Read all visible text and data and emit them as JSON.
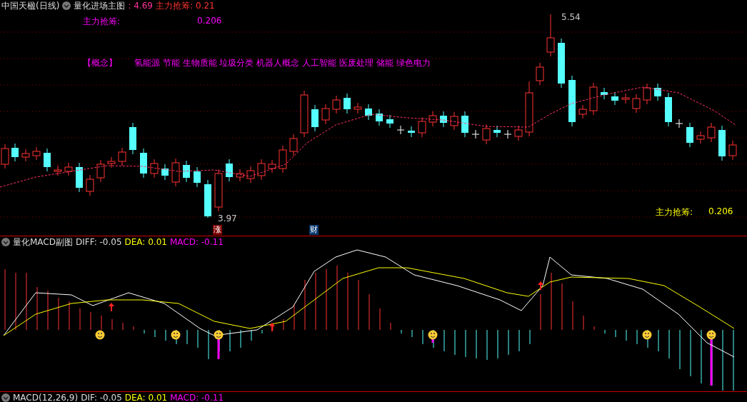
{
  "main_panel": {
    "title": "中国天楹(日线)",
    "indicator": "量化进场主图",
    "price": ": 4.69",
    "label": "主力抢筹:",
    "label_value": "0.21",
    "legend": {
      "label": "主力抢筹:",
      "value": "0.206"
    },
    "concept": {
      "tag": "【概念】",
      "items": "氢能源 节能 生物质能 垃圾分类 机器人概念 人工智能 医废处理 储能 绿色电力"
    },
    "high_label": "5.54",
    "low_label": "3.97",
    "markers": [
      {
        "text": "涨",
        "kind": "rise"
      },
      {
        "text": "财",
        "kind": "finance"
      }
    ],
    "corner": {
      "label": "主力抢筹:",
      "value": "0.206"
    }
  },
  "macd_panel": {
    "title": "量化MACD副图",
    "diff": "DIFF: -0.05",
    "dea": "DEA: 0.01",
    "macd": "MACD: -0.11"
  },
  "bottom_panel": {
    "title": "MACD(12,26,9)",
    "dif": "DIF: -0.05",
    "dea": "DEA: 0.01",
    "macd": "MACD: -0.11"
  }
}
